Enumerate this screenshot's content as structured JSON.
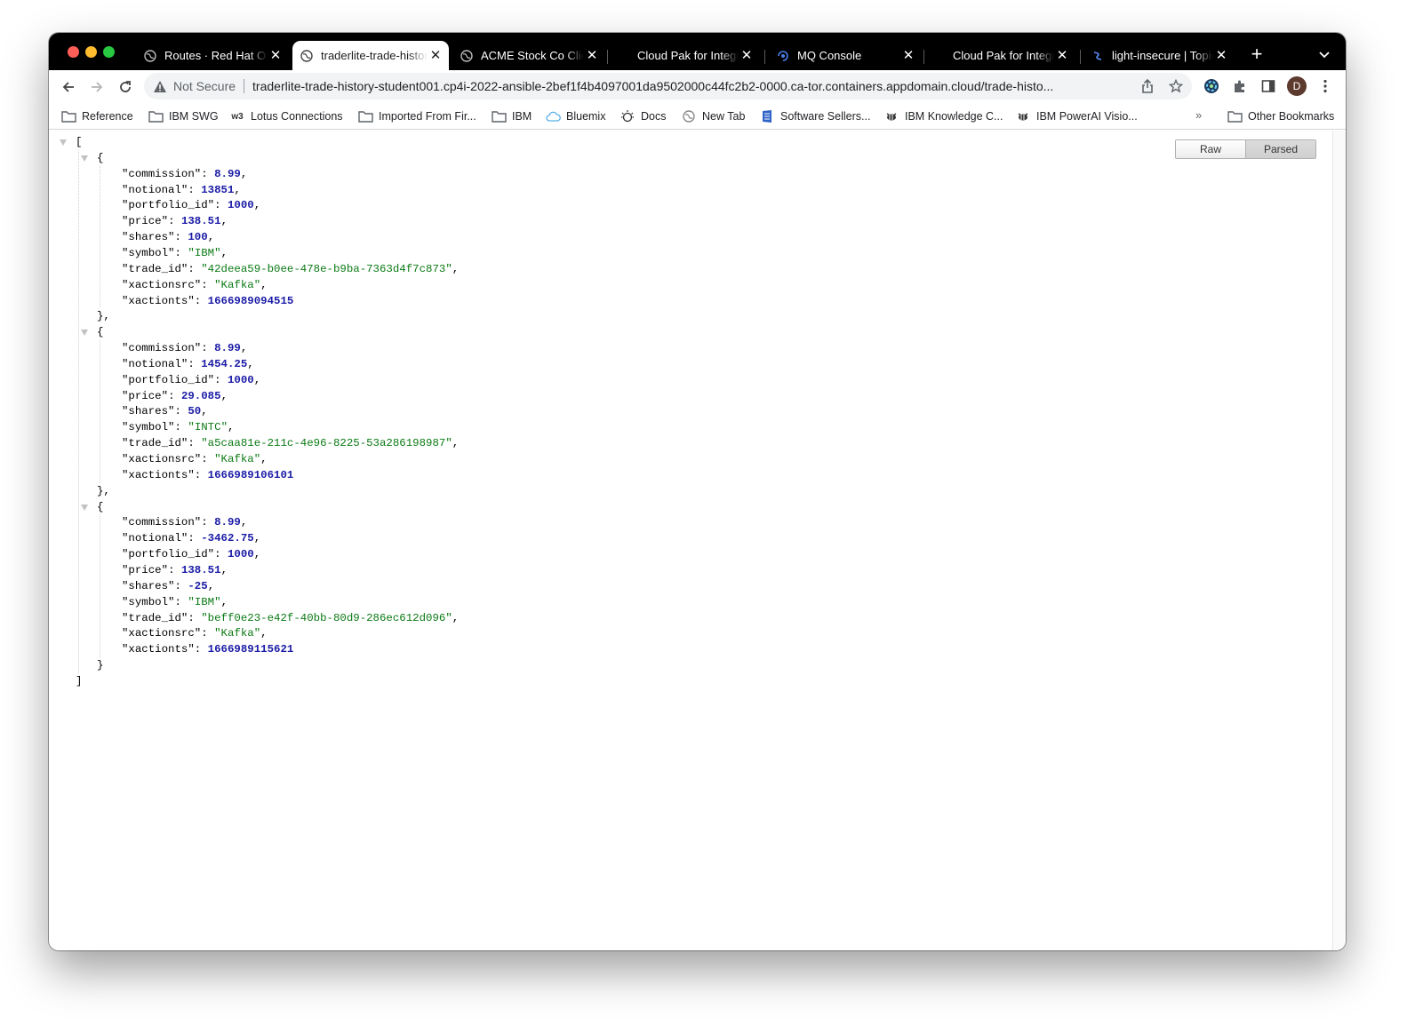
{
  "tabs": [
    {
      "title": "Routes · Red Hat OpenShift",
      "icon": "globe-icon",
      "active": false
    },
    {
      "title": "traderlite-trade-history",
      "icon": "globe-icon",
      "active": true
    },
    {
      "title": "ACME Stock Co Client",
      "icon": "globe-icon",
      "active": false
    },
    {
      "title": "Cloud Pak for Integration",
      "icon": "",
      "active": false
    },
    {
      "title": "MQ Console",
      "icon": "mq-icon",
      "active": false
    },
    {
      "title": "Cloud Pak for Integration",
      "icon": "",
      "active": false
    },
    {
      "title": "light-insecure | Topics",
      "icon": "event-streams-icon",
      "active": false
    }
  ],
  "toolbar": {
    "security_label": "Not Secure",
    "url": "traderlite-trade-history-student001.cp4i-2022-ansible-2bef1f4b4097001da9502000c44fc2b2-0000.ca-tor.containers.appdomain.cloud/trade-histo...",
    "avatar_initial": "D"
  },
  "bookmarks": [
    {
      "label": "Reference",
      "icon": "folder-icon"
    },
    {
      "label": "IBM SWG",
      "icon": "folder-icon"
    },
    {
      "label": "Lotus Connections",
      "icon": "w3-icon"
    },
    {
      "label": "Imported From Fir...",
      "icon": "folder-icon"
    },
    {
      "label": "IBM",
      "icon": "folder-icon"
    },
    {
      "label": "Bluemix",
      "icon": "cloud-icon"
    },
    {
      "label": "Docs",
      "icon": "bulb-icon"
    },
    {
      "label": "New Tab",
      "icon": "globe-icon"
    },
    {
      "label": "Software Sellers...",
      "icon": "sellers-icon"
    },
    {
      "label": "IBM Knowledge C...",
      "icon": "bee-icon"
    },
    {
      "label": "IBM PowerAI Visio...",
      "icon": "bee-icon"
    }
  ],
  "bookmarks_overflow": "»",
  "other_bookmarks": "Other Bookmarks",
  "viewer": {
    "raw_label": "Raw",
    "parsed_label": "Parsed",
    "selected": "Parsed"
  },
  "trades": [
    {
      "commission": "8.99",
      "notional": "13851",
      "portfolio_id": "1000",
      "price": "138.51",
      "shares": "100",
      "symbol": "IBM",
      "trade_id": "42deea59-b0ee-478e-b9ba-7363d4f7c873",
      "xactionsrc": "Kafka",
      "xactionts": "1666989094515"
    },
    {
      "commission": "8.99",
      "notional": "1454.25",
      "portfolio_id": "1000",
      "price": "29.085",
      "shares": "50",
      "symbol": "INTC",
      "trade_id": "a5caa81e-211c-4e96-8225-53a286198987",
      "xactionsrc": "Kafka",
      "xactionts": "1666989106101"
    },
    {
      "commission": "8.99",
      "notional": "-3462.75",
      "portfolio_id": "1000",
      "price": "138.51",
      "shares": "-25",
      "symbol": "IBM",
      "trade_id": "beff0e23-e42f-40bb-80d9-286ec612d096",
      "xactionsrc": "Kafka",
      "xactionts": "1666989115621"
    }
  ]
}
